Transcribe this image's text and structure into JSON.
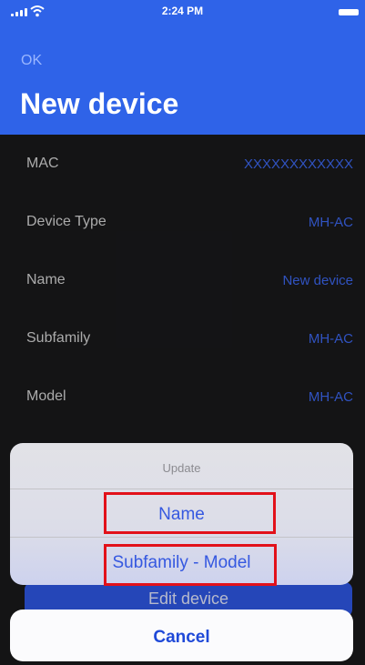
{
  "status_bar": {
    "time": "2:24 PM"
  },
  "header": {
    "ok_label": "OK",
    "title": "New device",
    "color": "#2f63e8"
  },
  "rows": [
    {
      "label": "MAC",
      "value": "XXXXXXXXXXXX"
    },
    {
      "label": "Device Type",
      "value": "MH-AC"
    },
    {
      "label": "Name",
      "value": "New device"
    },
    {
      "label": "Subfamily",
      "value": "MH-AC"
    },
    {
      "label": "Model",
      "value": "MH-AC"
    }
  ],
  "edit_bar": {
    "label": "Edit device"
  },
  "action_sheet": {
    "title": "Update",
    "options": [
      {
        "label": "Name",
        "highlighted": true
      },
      {
        "label": "Subfamily - Model",
        "highlighted": true
      }
    ],
    "cancel_label": "Cancel"
  },
  "colors": {
    "value_text": "#3d68f2",
    "highlight_border": "#e2111a",
    "background": "#19191b"
  }
}
